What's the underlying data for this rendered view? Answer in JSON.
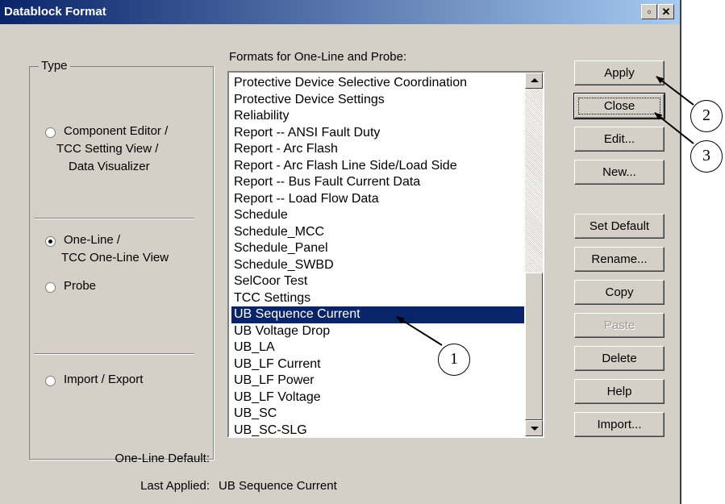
{
  "window": {
    "title": "Datablock Format"
  },
  "title_buttons": {
    "restore_glyph": "▫",
    "close_glyph": "✕"
  },
  "type_group": {
    "title": "Type",
    "options": [
      {
        "id": "component-editor",
        "lines": [
          "Component Editor /",
          "TCC Setting View /",
          "Data Visualizer"
        ],
        "checked": false
      },
      {
        "id": "one-line",
        "lines": [
          "One-Line /",
          "TCC One-Line View"
        ],
        "checked": true
      },
      {
        "id": "probe",
        "lines": [
          "Probe"
        ],
        "checked": false
      },
      {
        "id": "import-export",
        "lines": [
          "Import / Export"
        ],
        "checked": false
      }
    ]
  },
  "formats": {
    "label": "Formats for One-Line and Probe:",
    "items": [
      "Protective Device Selective Coordination",
      "Protective Device Settings",
      "Reliability",
      "Report -- ANSI Fault Duty",
      "Report - Arc Flash",
      "Report - Arc Flash Line Side/Load Side",
      "Report -- Bus Fault Current Data",
      "Report -- Load Flow Data",
      "Schedule",
      "Schedule_MCC",
      "Schedule_Panel",
      "Schedule_SWBD",
      "SelCoor Test",
      "TCC Settings",
      "UB Sequence Current",
      "UB Voltage Drop",
      "UB_LA",
      "UB_LF Current",
      "UB_LF Power",
      "UB_LF Voltage",
      "UB_SC",
      "UB_SC-SLG"
    ],
    "selected": "UB Sequence Current"
  },
  "buttons": {
    "apply": "Apply",
    "close": "Close",
    "edit": "Edit...",
    "new": "New...",
    "set_default": "Set Default",
    "rename": "Rename...",
    "copy": "Copy",
    "paste": "Paste",
    "delete": "Delete",
    "help": "Help",
    "import": "Import..."
  },
  "footer": {
    "one_line_default_label": "One-Line Default:",
    "one_line_default_value": "",
    "last_applied_label": "Last Applied:",
    "last_applied_value": "UB Sequence Current"
  },
  "callouts": [
    "1",
    "2",
    "3"
  ],
  "colors": {
    "title_bar": "#0a246a",
    "selection": "#0a246a",
    "dialog_face": "#d4d0c8"
  }
}
